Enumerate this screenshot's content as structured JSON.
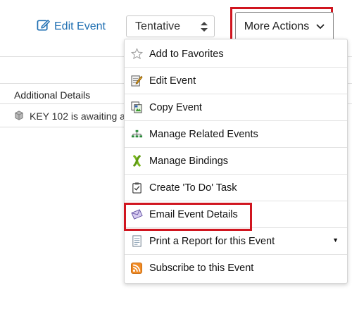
{
  "toolbar": {
    "edit_label": "Edit Event",
    "status_value": "Tentative",
    "more_actions_label": "More Actions"
  },
  "details": {
    "header": "Additional Details",
    "row_text": "KEY 102  is awaiting a"
  },
  "menu": {
    "items": [
      {
        "label": "Add to Favorites",
        "icon": "star-icon"
      },
      {
        "label": "Edit Event",
        "icon": "edit-note-icon"
      },
      {
        "label": "Copy Event",
        "icon": "copy-icon"
      },
      {
        "label": "Manage Related Events",
        "icon": "hierarchy-icon"
      },
      {
        "label": "Manage Bindings",
        "icon": "bindings-icon"
      },
      {
        "label": "Create 'To Do' Task",
        "icon": "clipboard-icon"
      },
      {
        "label": "Email Event Details",
        "icon": "envelope-icon"
      },
      {
        "label": "Print a Report for this Event",
        "icon": "report-icon",
        "has_submenu": true
      },
      {
        "label": "Subscribe to this Event",
        "icon": "rss-icon"
      }
    ]
  },
  "colors": {
    "link_blue": "#1f6fb2",
    "highlight_red": "#d0151f"
  }
}
